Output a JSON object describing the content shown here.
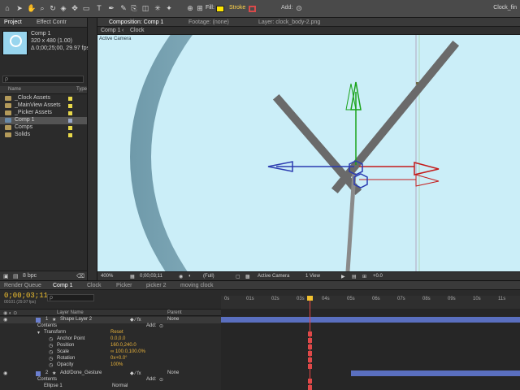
{
  "app": {
    "title": "Clock_fin"
  },
  "toolbar": {
    "fill_label": "Fill:",
    "stroke_label": "Stroke",
    "add_label": "Add:",
    "tools": [
      "home-icon",
      "selection-icon",
      "hand-icon",
      "zoom-icon",
      "rotate-icon",
      "camera-icon",
      "pan-behind-icon",
      "rectangle-icon",
      "pen-icon",
      "text-icon",
      "brush-icon",
      "clone-icon",
      "eraser-icon",
      "roto-icon",
      "puppet-icon"
    ],
    "fill_color": "#ffe600",
    "stroke_color": "#d84a4a"
  },
  "project": {
    "tabs": [
      "Project",
      "Effect Contr"
    ],
    "selected_item": "Comp 1",
    "meta_line1": "320 x 480 (1.00)",
    "meta_line2": "Δ 0;00;25;00, 29.97 fps",
    "search_placeholder": "ρ",
    "headers": {
      "name": "Name",
      "type": "Type"
    },
    "items": [
      {
        "name": "_Clock Assets",
        "type": "folder"
      },
      {
        "name": "_MainView Assets",
        "type": "folder"
      },
      {
        "name": "_Picker Assets",
        "type": "folder"
      },
      {
        "name": "Comp 1",
        "type": "comp"
      },
      {
        "name": "Comps",
        "type": "folder"
      },
      {
        "name": "Solids",
        "type": "folder"
      }
    ],
    "bpc": "8 bpc"
  },
  "composition": {
    "tabs": [
      "Composition: Comp 1",
      "Footage: (none)",
      "Layer: clock_body-2.png"
    ],
    "breadcrumb": [
      "Comp 1",
      "Clock"
    ],
    "view_label": "Active Camera",
    "footer": {
      "zoom": "400%",
      "timecode": "0;00;03;11",
      "resolution": "(Full)",
      "camera": "Active Camera",
      "views": "1 View",
      "exposure": "+0.0"
    },
    "accent_bg": "#cbeef8"
  },
  "timeline": {
    "tabs": [
      "Render Queue",
      "Comp 1",
      "Clock",
      "Picker",
      "picker 2",
      "moving clock"
    ],
    "timecode": "0;00;03;11",
    "fps_line": "00101 (29.97 fps)",
    "search_placeholder": "ρ",
    "ruler": [
      "0s",
      "01s",
      "02s",
      "03s",
      "04s",
      "05s",
      "06s",
      "07s",
      "08s",
      "09s",
      "10s",
      "11s"
    ],
    "header": {
      "layer_name": "Layer Name",
      "parent": "Parent"
    },
    "layers": [
      {
        "kind": "layer",
        "num": "1",
        "name": "Shape Layer 2",
        "parent": "None",
        "add": "Add:"
      },
      {
        "kind": "group",
        "name": "Contents"
      },
      {
        "kind": "group",
        "name": "Transform",
        "value": "Reset"
      },
      {
        "kind": "prop",
        "name": "Anchor Point",
        "value": "0.0,0.0"
      },
      {
        "kind": "prop",
        "name": "Position",
        "value": "160.0,240.0"
      },
      {
        "kind": "prop",
        "name": "Scale",
        "value": "∞ 100.0,100.0%"
      },
      {
        "kind": "prop",
        "name": "Rotation",
        "value": "0x+0.0°"
      },
      {
        "kind": "prop",
        "name": "Opacity",
        "value": "100%"
      },
      {
        "kind": "layer",
        "num": "2",
        "name": "Add/Done_Gesture",
        "parent": "None",
        "add": "Add:"
      },
      {
        "kind": "group",
        "name": "Contents"
      },
      {
        "kind": "group",
        "name": "Ellipse 1",
        "value": "Normal"
      }
    ]
  }
}
